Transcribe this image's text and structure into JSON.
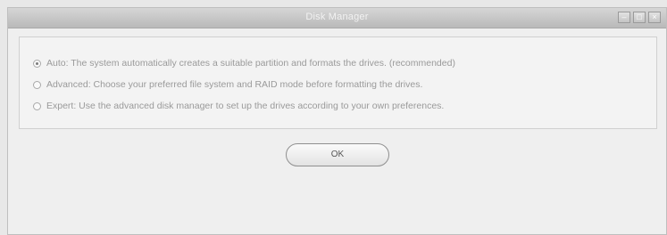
{
  "window": {
    "title": "Disk Manager",
    "controls": {
      "minimize": "–",
      "maximize": "□",
      "close": "×"
    }
  },
  "options": [
    {
      "label": "Auto: The system automatically creates a suitable partition and formats the drives. (recommended)",
      "selected": true
    },
    {
      "label": "Advanced: Choose your preferred file system and RAID mode before formatting the drives.",
      "selected": false
    },
    {
      "label": "Expert: Use the advanced disk manager to set up the drives according to your own preferences.",
      "selected": false
    }
  ],
  "buttons": {
    "ok_label": "OK"
  }
}
